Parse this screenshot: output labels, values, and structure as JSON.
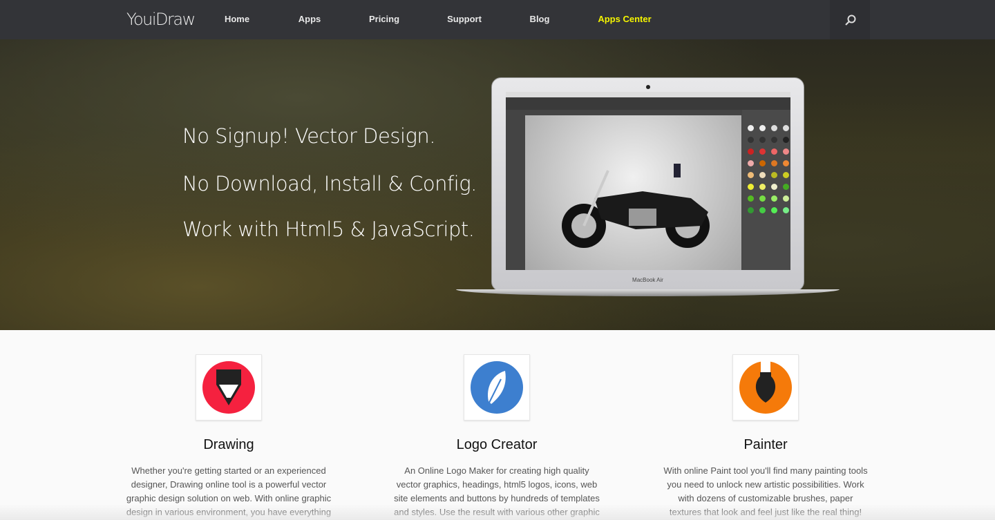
{
  "nav": {
    "logo": "YouiDraw",
    "items": [
      "Home",
      "Apps",
      "Pricing",
      "Support",
      "Blog",
      "Apps Center"
    ],
    "active_color": "#f5f500",
    "search_icon": "search-icon"
  },
  "hero": {
    "lines": [
      "No Signup! Vector Design.",
      "No Download, Install & Config.",
      "Work with Html5 & JavaScript."
    ],
    "laptop_label": "MacBook Air"
  },
  "apps": [
    {
      "title": "Drawing",
      "icon": "pencil-icon",
      "color": "#f5213f",
      "text": "Whether you're getting started or an experienced designer, Drawing online tool is a powerful vector graphic design solution on web. With online graphic design in various environment, you have everything"
    },
    {
      "title": "Logo Creator",
      "icon": "feather-icon",
      "color": "#3d7fcf",
      "text": "An Online Logo Maker for creating high quality vector graphics, headings, html5 logos, icons, web site elements and buttons by hundreds of templates and styles. Use the result with various other graphic"
    },
    {
      "title": "Painter",
      "icon": "brush-icon",
      "color": "#f57a0a",
      "text": "With online Paint tool you'll find many painting tools you need to unlock new artistic possibilities. Work with dozens of customizable brushes, paper textures that look and feel just like the real thing!"
    }
  ]
}
